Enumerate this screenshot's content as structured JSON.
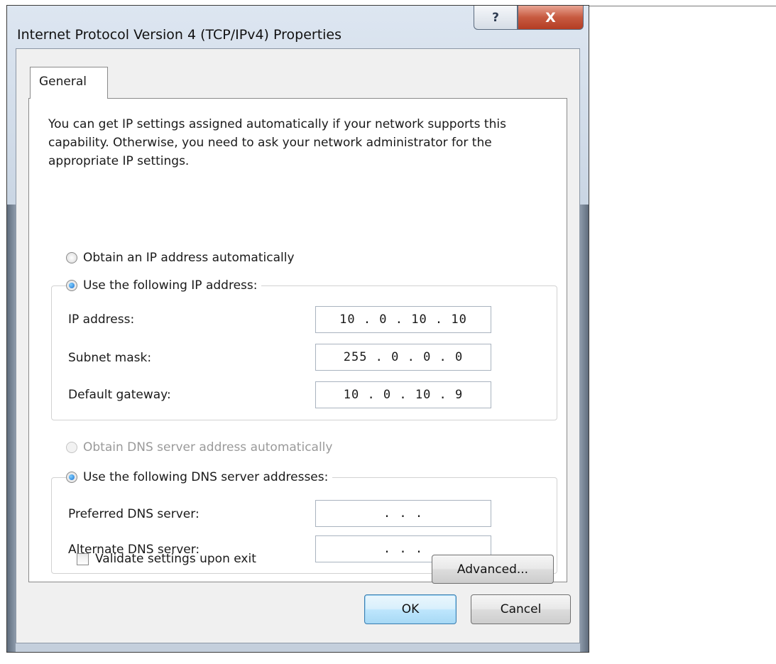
{
  "window": {
    "title": "Internet Protocol Version 4 (TCP/IPv4) Properties",
    "help_glyph": "?",
    "close_glyph": "X"
  },
  "tabs": [
    {
      "label": "General",
      "selected": true
    }
  ],
  "intro_text": "You can get IP settings assigned automatically if your network supports this capability. Otherwise, you need to ask your network administrator for the appropriate IP settings.",
  "ip_mode": {
    "auto_label": "Obtain an IP address automatically",
    "manual_label": "Use the following IP address:",
    "selected": "manual"
  },
  "ip_fields": [
    {
      "label": "IP address:",
      "value": "10 . 0 . 10 . 10"
    },
    {
      "label": "Subnet mask:",
      "value": "255 . 0 . 0 . 0"
    },
    {
      "label": "Default gateway:",
      "value": "10 . 0 . 10 . 9"
    }
  ],
  "dns_mode": {
    "auto_label": "Obtain DNS server address automatically",
    "manual_label": "Use the following DNS server addresses:",
    "selected": "manual",
    "auto_disabled": true
  },
  "dns_fields": [
    {
      "label": "Preferred DNS server:",
      "value": ". . ."
    },
    {
      "label": "Alternate DNS server:",
      "value": ". . ."
    }
  ],
  "validate": {
    "label": "Validate settings upon exit",
    "checked": false
  },
  "buttons": {
    "advanced": "Advanced...",
    "ok": "OK",
    "cancel": "Cancel"
  }
}
